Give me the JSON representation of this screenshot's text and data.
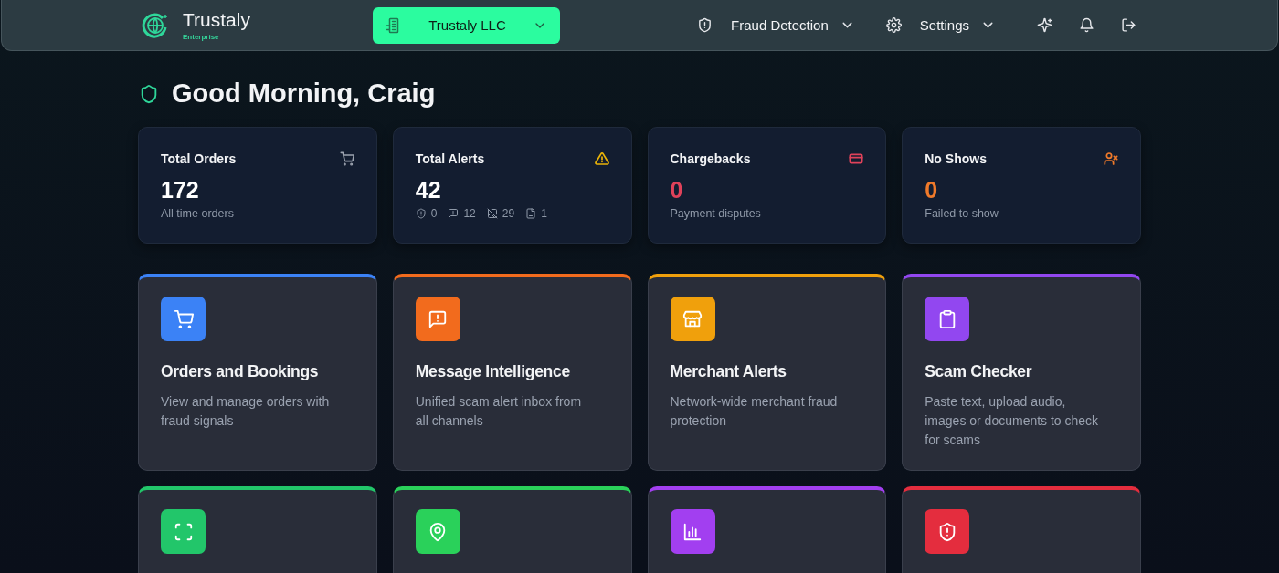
{
  "header": {
    "brand": "Trustaly",
    "edition": "Enterprise",
    "org_selector": "Trustaly LLC",
    "nav": [
      {
        "kind": "shield",
        "label": "Fraud Detection"
      },
      {
        "kind": "gear",
        "label": "Settings"
      }
    ]
  },
  "greeting": "Good Morning, Craig",
  "stats": [
    {
      "kind": "cart",
      "title": "Total Orders",
      "value": "172",
      "caption": "All time orders",
      "color": "#9ca3af",
      "accent": false
    },
    {
      "kind": "warning",
      "title": "Total Alerts",
      "value": "42",
      "breakdown": [
        {
          "kind": "shield",
          "count": "0"
        },
        {
          "kind": "message",
          "count": "12"
        },
        {
          "kind": "image-off",
          "count": "29"
        },
        {
          "kind": "document",
          "count": "1"
        }
      ],
      "color": "#eab308",
      "accent": false
    },
    {
      "kind": "card",
      "title": "Chargebacks",
      "value": "0",
      "caption": "Payment disputes",
      "color": "#e0425a",
      "accent": true
    },
    {
      "kind": "user-x",
      "title": "No Shows",
      "value": "0",
      "caption": "Failed to show",
      "color": "#f07a2a",
      "accent": true
    }
  ],
  "features": [
    {
      "kind": "cart",
      "title": "Orders and Bookings",
      "description": "View and manage orders with fraud signals",
      "color": "#3b82f6"
    },
    {
      "kind": "message",
      "title": "Message Intelligence",
      "description": "Unified scam alert inbox from all channels",
      "color": "#f26b1d"
    },
    {
      "kind": "store",
      "title": "Merchant Alerts",
      "description": "Network-wide merchant fraud protection",
      "color": "#f0a00c"
    },
    {
      "kind": "clipboard",
      "title": "Scam Checker",
      "description": "Paste text, upload audio, images or documents to check for scams",
      "color": "#9247f0"
    },
    {
      "kind": "scan",
      "color": "#22c66a"
    },
    {
      "kind": "pin",
      "color": "#2ad15a"
    },
    {
      "kind": "chart",
      "color": "#a23ff0"
    },
    {
      "kind": "shield",
      "color": "#e42d3e"
    }
  ]
}
